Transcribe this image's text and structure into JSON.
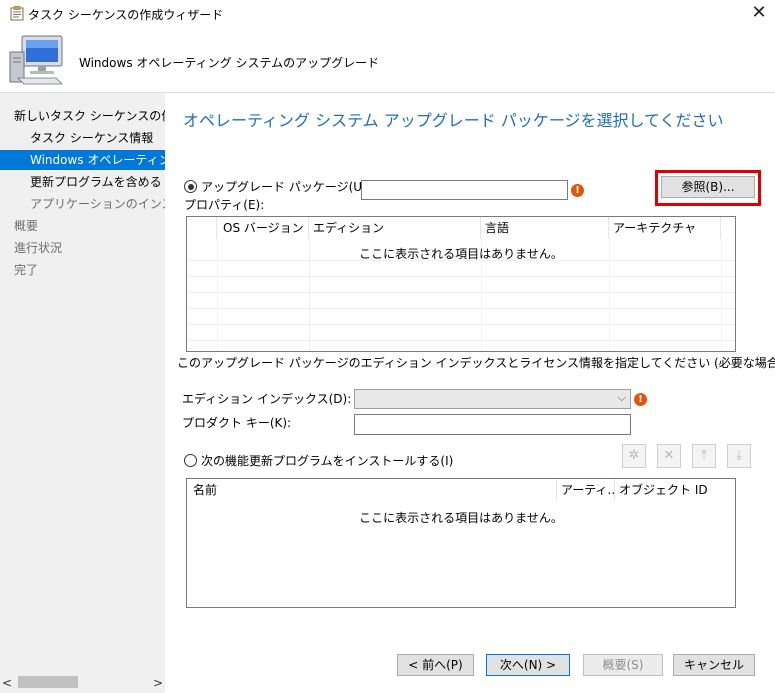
{
  "window": {
    "title": "タスク シーケンスの作成ウィザード",
    "header": "Windows オペレーティング システムのアップグレード"
  },
  "sidebar": {
    "items": [
      {
        "label": "新しいタスク シーケンスの作成",
        "state": "normal",
        "indent": 0
      },
      {
        "label": "タスク シーケンス情報",
        "state": "normal",
        "indent": 1
      },
      {
        "label": "Windows オペレーティング システムのアップグレード",
        "state": "active",
        "indent": 1
      },
      {
        "label": "更新プログラムを含める",
        "state": "normal",
        "indent": 1
      },
      {
        "label": "アプリケーションのインストール",
        "state": "disabled",
        "indent": 1
      },
      {
        "label": "概要",
        "state": "disabled",
        "indent": 0
      },
      {
        "label": "進行状況",
        "state": "disabled",
        "indent": 0
      },
      {
        "label": "完了",
        "state": "disabled",
        "indent": 0
      }
    ]
  },
  "main": {
    "heading": "オペレーティング システム アップグレード パッケージを選択してください",
    "upgrade_package_label": "アップグレード パッケージ(U):",
    "upgrade_package_value": "",
    "browse_label": "参照(B)...",
    "properties_label": "プロパティ(E):",
    "properties_columns": [
      "",
      "OS バージョン",
      "エディション",
      "言語",
      "アーキテクチャ"
    ],
    "properties_empty": "ここに表示される項目はありません。",
    "edition_note": "このアップグレード パッケージのエディション インデックスとライセンス情報を指定してください (必要な場合)。",
    "edition_index_label": "エディション インデックス(D):",
    "edition_index_value": "",
    "product_key_label": "プロダクト キー(K):",
    "product_key_value": "",
    "feature_update_label": "次の機能更新プログラムをインストールする(I)",
    "feature_columns": [
      "名前",
      "アーティ...",
      "オブジェクト ID"
    ],
    "feature_empty": "ここに表示される項目はありません。",
    "toolbar_icons": [
      "star-icon",
      "delete-icon",
      "move-up-icon",
      "move-down-icon"
    ]
  },
  "footer": {
    "back_label": "< 前へ(P)",
    "next_label": "次へ(N) >",
    "summary_label": "概要(S)",
    "cancel_label": "キャンセル"
  },
  "colors": {
    "accent": "#0078d7",
    "heading": "#1f6fb5",
    "highlight": "#e00000",
    "error": "#e0560b"
  }
}
